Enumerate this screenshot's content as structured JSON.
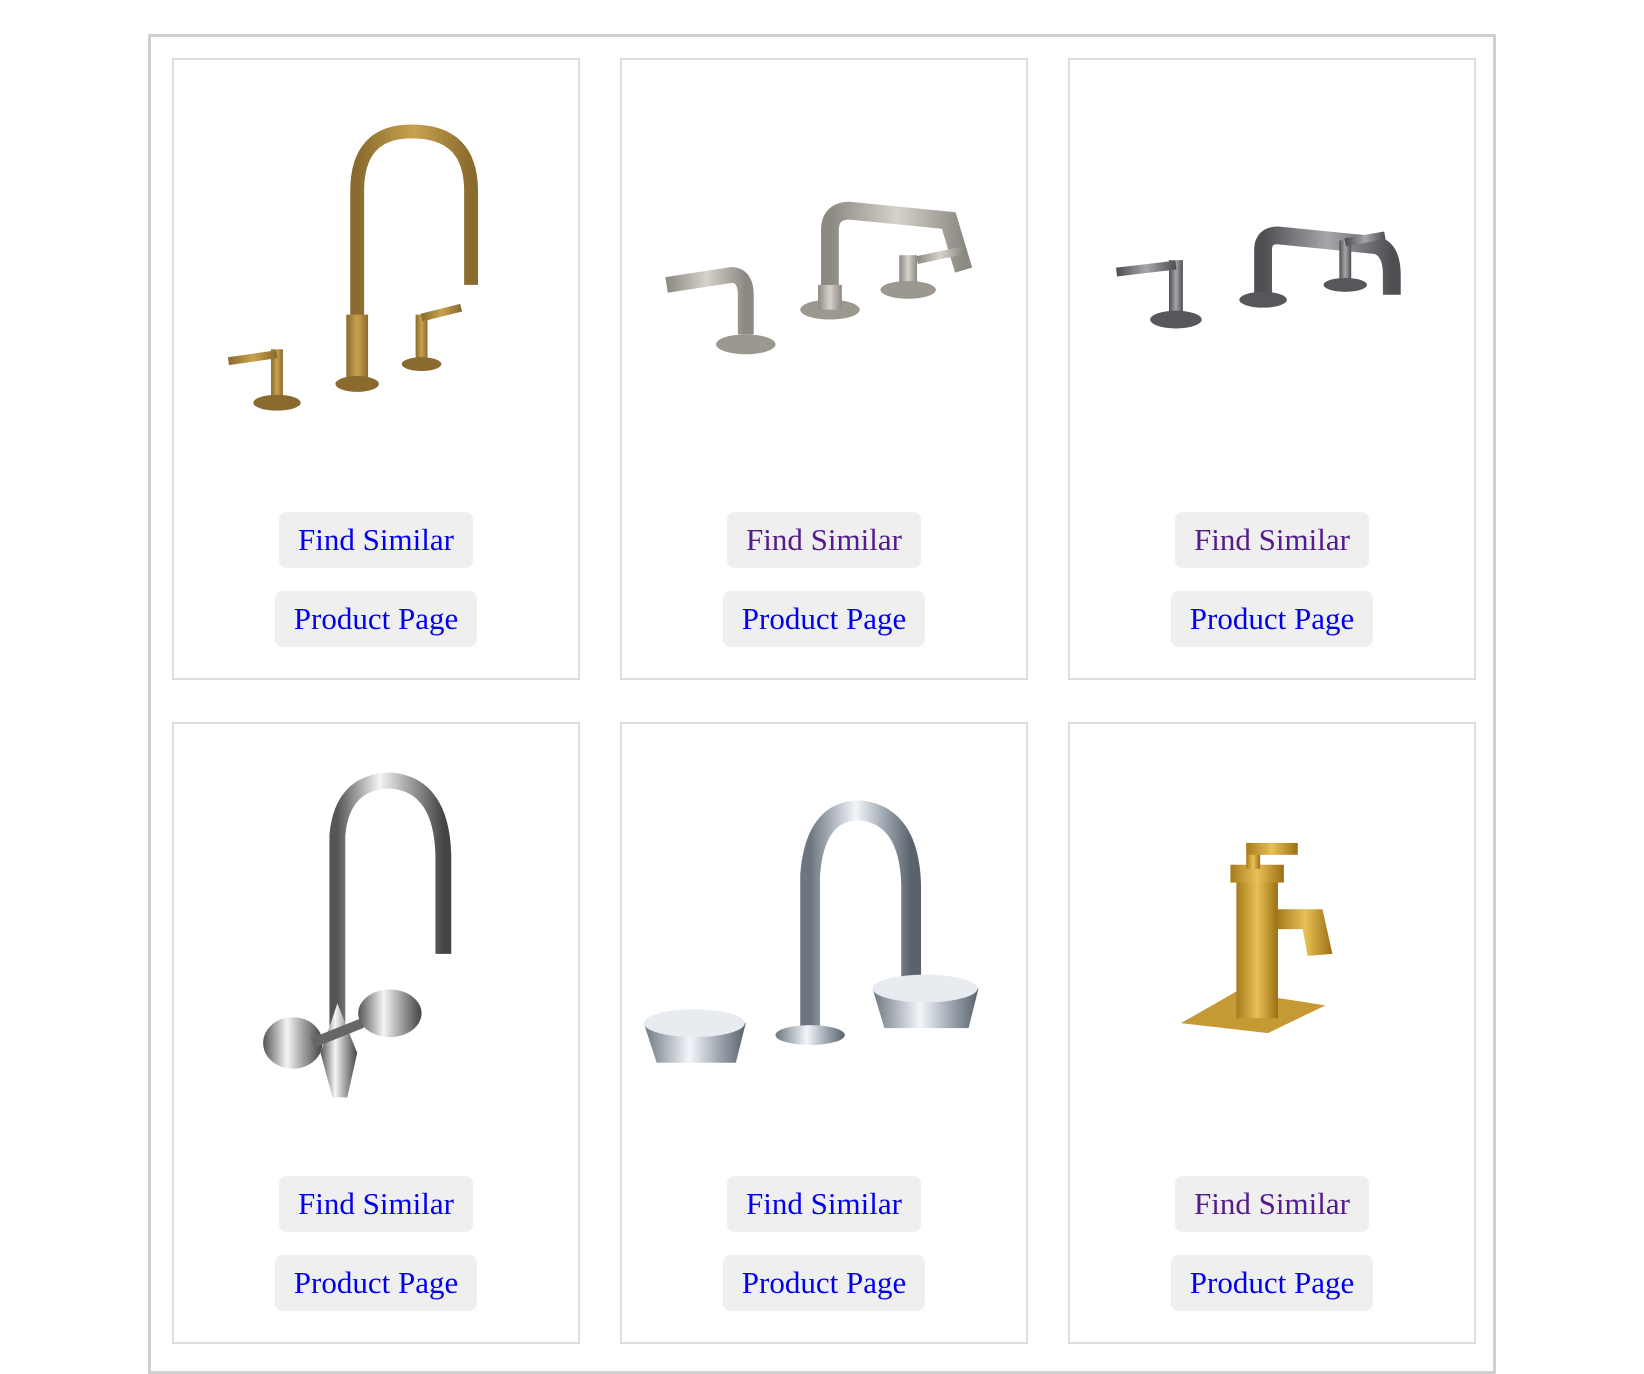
{
  "products": [
    {
      "id": "p1",
      "icon": "brass-gooseneck-faucet-icon",
      "find_label": "Find Similar",
      "product_label": "Product Page",
      "find_visited": false
    },
    {
      "id": "p2",
      "icon": "nickel-low-spout-faucet-icon",
      "find_label": "Find Similar",
      "product_label": "Product Page",
      "find_visited": true
    },
    {
      "id": "p3",
      "icon": "graphite-widespread-faucet-icon",
      "find_label": "Find Similar",
      "product_label": "Product Page",
      "find_visited": true
    },
    {
      "id": "p4",
      "icon": "chrome-shell-handle-faucet-icon",
      "find_label": "Find Similar",
      "product_label": "Product Page",
      "find_visited": false
    },
    {
      "id": "p5",
      "icon": "chrome-cone-handle-faucet-icon",
      "find_label": "Find Similar",
      "product_label": "Product Page",
      "find_visited": false
    },
    {
      "id": "p6",
      "icon": "gold-single-handle-faucet-icon",
      "find_label": "Find Similar",
      "product_label": "Product Page",
      "find_visited": true
    }
  ],
  "colors": {
    "link": "#0000ee",
    "visited": "#551a8b",
    "button_bg": "#efefef",
    "border": "#dddddd"
  }
}
